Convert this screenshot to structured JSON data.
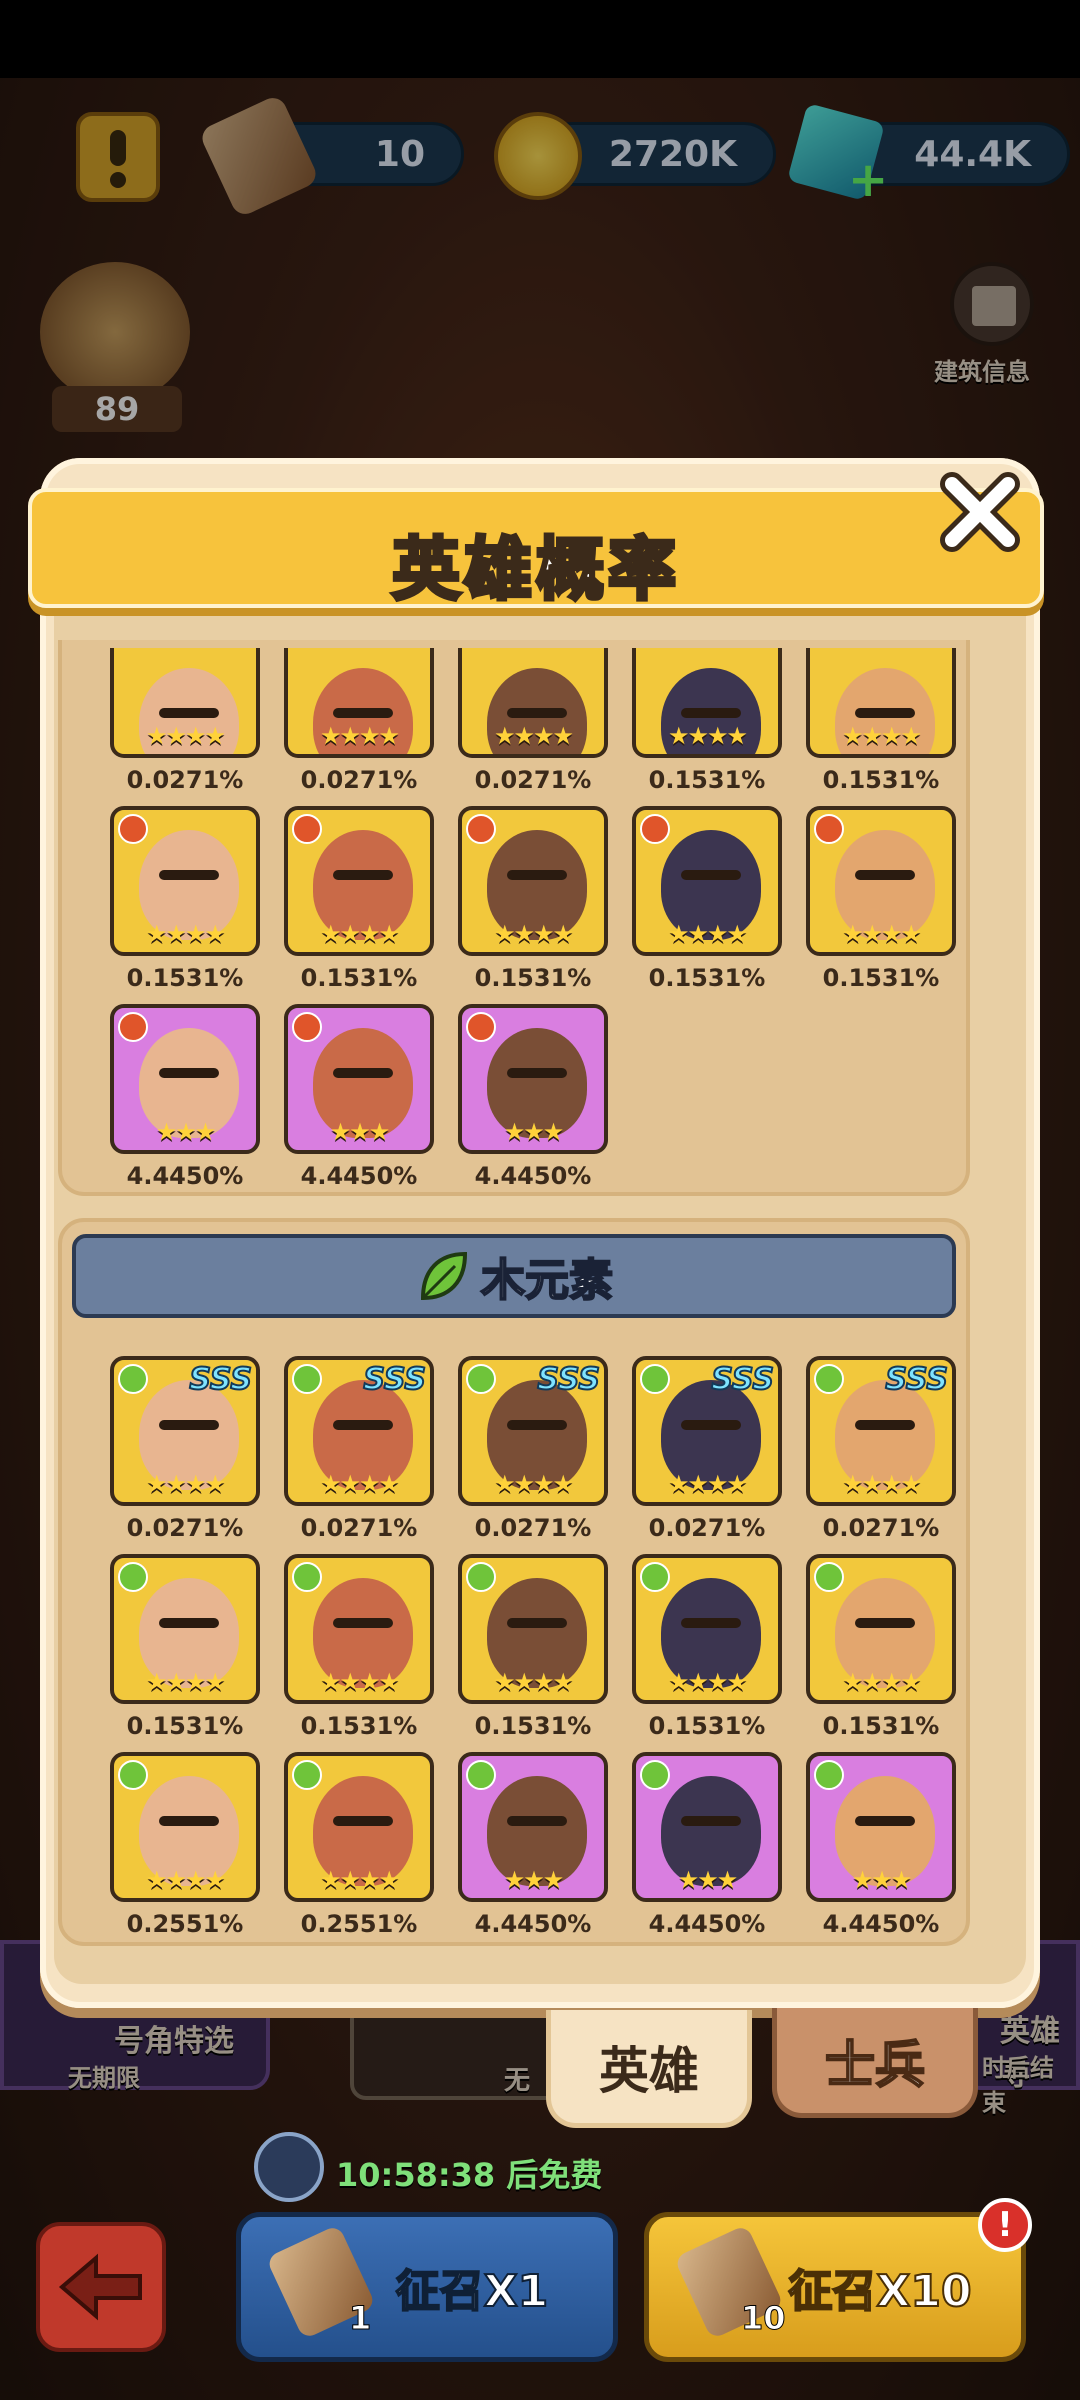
{
  "topbar": {
    "scroll_count": "10",
    "gold": "2720K",
    "gems": "44.4K",
    "horn_count": "89"
  },
  "side": {
    "building_info": "建筑信息",
    "left_promo_title": "号角特选",
    "left_promo_sub": "无期限",
    "mid_promo_sub": "无",
    "right_promo_title": "英雄寻",
    "right_promo_sub": "时后结束"
  },
  "modal": {
    "title": "英雄概率",
    "fire_section": {
      "rows": [
        {
          "cards": [
            {
              "stars": "★★★★",
              "pct": "0.0271%",
              "color": "#f2c83c"
            },
            {
              "stars": "★★★★",
              "pct": "0.0271%",
              "color": "#f2c83c"
            },
            {
              "stars": "★★★★",
              "pct": "0.0271%",
              "color": "#f2c83c"
            },
            {
              "stars": "★★★★",
              "pct": "0.1531%",
              "color": "#f2c83c"
            },
            {
              "stars": "★★★★",
              "pct": "0.1531%",
              "color": "#f2c83c"
            }
          ]
        },
        {
          "cards": [
            {
              "stars": "★★★★",
              "pct": "0.1531%",
              "color": "#f2c83c"
            },
            {
              "stars": "★★★★",
              "pct": "0.1531%",
              "color": "#f2c83c"
            },
            {
              "stars": "★★★★",
              "pct": "0.1531%",
              "color": "#f2c83c"
            },
            {
              "stars": "★★★★",
              "pct": "0.1531%",
              "color": "#f2c83c"
            },
            {
              "stars": "★★★★",
              "pct": "0.1531%",
              "color": "#f2c83c"
            }
          ]
        },
        {
          "cards": [
            {
              "stars": "★★★",
              "pct": "4.4450%",
              "color": "#d97ee0"
            },
            {
              "stars": "★★★",
              "pct": "4.4450%",
              "color": "#d97ee0"
            },
            {
              "stars": "★★★",
              "pct": "4.4450%",
              "color": "#d97ee0"
            }
          ]
        }
      ]
    },
    "wood_section": {
      "header": "木元素",
      "rows": [
        {
          "cards": [
            {
              "stars": "★★★★",
              "pct": "0.0271%",
              "color": "#f2c83c",
              "sss": "SSS"
            },
            {
              "stars": "★★★★",
              "pct": "0.0271%",
              "color": "#f2c83c",
              "sss": "SSS"
            },
            {
              "stars": "★★★★",
              "pct": "0.0271%",
              "color": "#f2c83c",
              "sss": "SSS"
            },
            {
              "stars": "★★★★",
              "pct": "0.0271%",
              "color": "#f2c83c",
              "sss": "SSS"
            },
            {
              "stars": "★★★★",
              "pct": "0.0271%",
              "color": "#f2c83c",
              "sss": "SSS"
            }
          ]
        },
        {
          "cards": [
            {
              "stars": "★★★★",
              "pct": "0.1531%",
              "color": "#f2c83c"
            },
            {
              "stars": "★★★★",
              "pct": "0.1531%",
              "color": "#f2c83c"
            },
            {
              "stars": "★★★★",
              "pct": "0.1531%",
              "color": "#f2c83c"
            },
            {
              "stars": "★★★★",
              "pct": "0.1531%",
              "color": "#f2c83c"
            },
            {
              "stars": "★★★★",
              "pct": "0.1531%",
              "color": "#f2c83c"
            }
          ]
        },
        {
          "cards": [
            {
              "stars": "★★★★",
              "pct": "0.2551%",
              "color": "#f2c83c"
            },
            {
              "stars": "★★★★",
              "pct": "0.2551%",
              "color": "#f2c83c"
            },
            {
              "stars": "★★★",
              "pct": "4.4450%",
              "color": "#d97ee0"
            },
            {
              "stars": "★★★",
              "pct": "4.4450%",
              "color": "#d97ee0"
            },
            {
              "stars": "★★★",
              "pct": "4.4450%",
              "color": "#d97ee0"
            }
          ]
        }
      ]
    },
    "tabs": {
      "heroes": "英雄",
      "soldiers": "士兵"
    }
  },
  "footer": {
    "timer": "10:58:38 后免费",
    "summon_one": "征召X1",
    "summon_ten": "征召X10",
    "one_badge": "1",
    "ten_badge": "10",
    "alert": "!"
  }
}
